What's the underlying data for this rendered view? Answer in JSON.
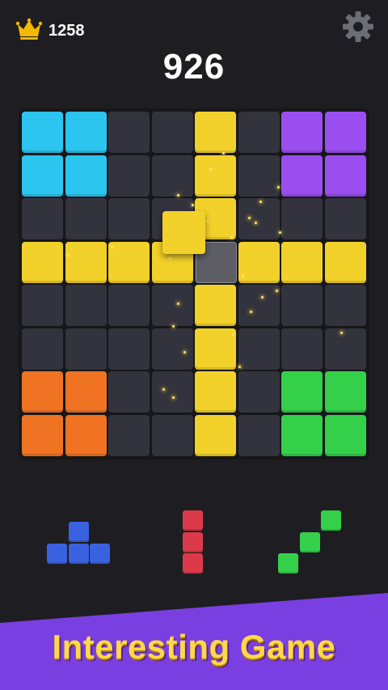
{
  "hud": {
    "best_score": "1258",
    "current_score": "926",
    "crown_icon": "crown-icon",
    "settings_icon": "gear-icon"
  },
  "colors": {
    "empty": "#33333d",
    "cyan": "#2bc5ef",
    "purple": "#9a4ef0",
    "yellow": "#f2d12a",
    "orange": "#ef7322",
    "green": "#34d04a",
    "blue": "#3a62e0",
    "red": "#dc3a4a"
  },
  "board": {
    "rows": [
      [
        "cyan",
        "cyan",
        "empty",
        "empty",
        "yellow",
        "empty",
        "purple",
        "purple"
      ],
      [
        "cyan",
        "cyan",
        "empty",
        "empty",
        "yellow",
        "empty",
        "purple",
        "purple"
      ],
      [
        "empty",
        "empty",
        "empty",
        "empty",
        "yellow",
        "empty",
        "empty",
        "empty"
      ],
      [
        "yellow",
        "yellow",
        "yellow",
        "yellow",
        "ghost",
        "yellow",
        "yellow",
        "yellow"
      ],
      [
        "empty",
        "empty",
        "empty",
        "empty",
        "yellow",
        "empty",
        "empty",
        "empty"
      ],
      [
        "empty",
        "empty",
        "empty",
        "empty",
        "yellow",
        "empty",
        "empty",
        "empty"
      ],
      [
        "orange",
        "orange",
        "empty",
        "empty",
        "yellow",
        "empty",
        "green",
        "green"
      ],
      [
        "orange",
        "orange",
        "empty",
        "empty",
        "yellow",
        "empty",
        "green",
        "green"
      ]
    ]
  },
  "tray": [
    {
      "name": "t-piece",
      "color": "blue",
      "cells": [
        [
          0,
          1
        ],
        [
          1,
          0
        ],
        [
          1,
          1
        ],
        [
          1,
          2
        ]
      ]
    },
    {
      "name": "i-piece",
      "color": "red",
      "cells": [
        [
          0,
          0
        ],
        [
          1,
          0
        ],
        [
          2,
          0
        ]
      ]
    },
    {
      "name": "diagonal-piece",
      "color": "green",
      "cells": [
        [
          0,
          2
        ],
        [
          1,
          1
        ],
        [
          2,
          0
        ]
      ]
    }
  ],
  "banner": {
    "text": "Interesting Game",
    "color": "#7a3fe0"
  }
}
